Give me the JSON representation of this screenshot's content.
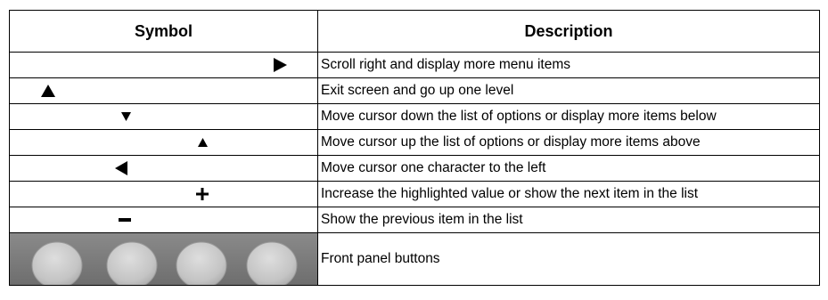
{
  "table": {
    "headers": {
      "symbol": "Symbol",
      "description": "Description"
    },
    "rows": [
      {
        "symbol_icon": "triangle-right-icon",
        "description": "Scroll right and display more menu items"
      },
      {
        "symbol_icon": "triangle-up-icon",
        "description": "Exit screen and go up one level"
      },
      {
        "symbol_icon": "triangle-down-icon",
        "description": "Move cursor down the list of options or display more items below"
      },
      {
        "symbol_icon": "triangle-up-small-icon",
        "description": "Move cursor up the list of options or display more items above"
      },
      {
        "symbol_icon": "triangle-left-icon",
        "description": "Move cursor one character to the left"
      },
      {
        "symbol_icon": "plus-icon",
        "description": "Increase the highlighted value or show the next item in the list"
      },
      {
        "symbol_icon": "minus-icon",
        "description": "Show the previous item in the list"
      },
      {
        "symbol_icon": "front-panel-buttons-image",
        "description": "Front panel buttons"
      }
    ]
  },
  "colors": {
    "border": "#000000",
    "panel_background": "#7b7b7b",
    "button_fill": "#c8c8c8"
  }
}
